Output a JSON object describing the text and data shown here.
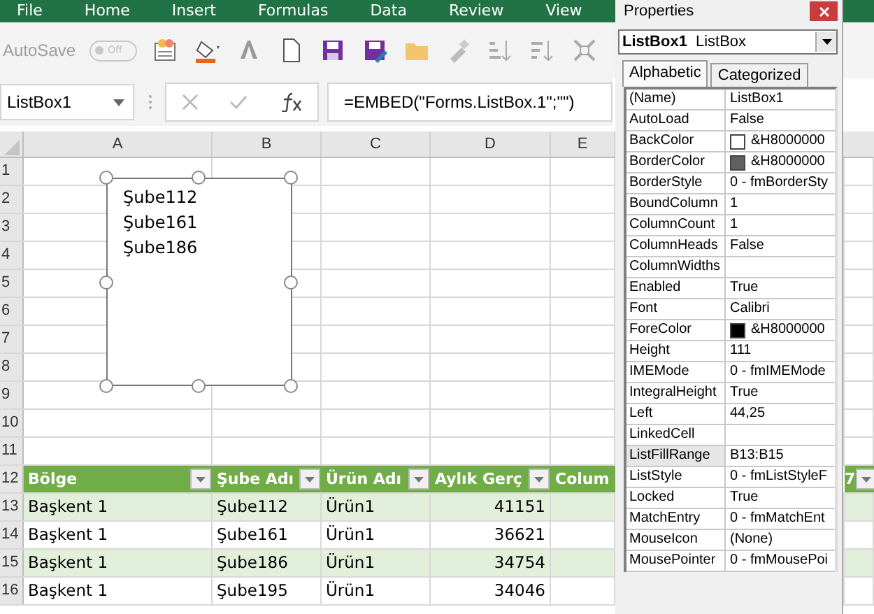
{
  "ribbon_tabs": [
    "File",
    "Home",
    "Insert",
    "Formulas",
    "Data",
    "Review",
    "View"
  ],
  "toolbar": {
    "autosave_label": "AutoSave",
    "autosave_state": "Off",
    "autosave_on": false
  },
  "formula_bar": {
    "name_box": "ListBox1",
    "formula": "=EMBED(\"Forms.ListBox.1\";\"\")"
  },
  "sheet": {
    "columns": [
      "A",
      "B",
      "C",
      "D",
      "E"
    ],
    "row_numbers": [
      "1",
      "2",
      "3",
      "4",
      "5",
      "6",
      "7",
      "8",
      "9",
      "10",
      "11",
      "12",
      "13",
      "14",
      "15",
      "16"
    ],
    "listbox_items": [
      "Şube112",
      "Şube161",
      "Şube186"
    ],
    "table": {
      "columns": [
        "Bölge",
        "Şube Adı",
        "Ürün Adı",
        "Aylık Gerç",
        "Colum",
        "7"
      ],
      "rows": [
        [
          "Başkent 1",
          "Şube112",
          "Ürün1",
          "41151"
        ],
        [
          "Başkent 1",
          "Şube161",
          "Ürün1",
          "36621"
        ],
        [
          "Başkent 1",
          "Şube186",
          "Ürün1",
          "34754"
        ],
        [
          "Başkent 1",
          "Şube195",
          "Ürün1",
          "34046"
        ]
      ]
    }
  },
  "properties": {
    "title": "Properties",
    "object_name": "ListBox1",
    "object_type": "ListBox",
    "tabs": [
      {
        "label": "Alphabetic",
        "selected": true
      },
      {
        "label": "Categorized",
        "selected": false
      }
    ],
    "rows": [
      {
        "name": "(Name)",
        "value": "ListBox1",
        "kind": "text",
        "selected": false
      },
      {
        "name": "AutoLoad",
        "value": "False",
        "kind": "text",
        "selected": false
      },
      {
        "name": "BackColor",
        "value": "&H8000000",
        "kind": "color",
        "color": "#ffffff",
        "selected": false
      },
      {
        "name": "BorderColor",
        "value": "&H8000000",
        "kind": "color",
        "color": "#606060",
        "selected": false
      },
      {
        "name": "BorderStyle",
        "value": "0 - fmBorderSty",
        "kind": "text",
        "selected": false
      },
      {
        "name": "BoundColumn",
        "value": "1",
        "kind": "text",
        "selected": false
      },
      {
        "name": "ColumnCount",
        "value": "1",
        "kind": "text",
        "selected": false
      },
      {
        "name": "ColumnHeads",
        "value": "False",
        "kind": "text",
        "selected": false
      },
      {
        "name": "ColumnWidths",
        "kind": "text",
        "selected": false
      },
      {
        "name": "Enabled",
        "value": "True",
        "kind": "text",
        "selected": false
      },
      {
        "name": "Font",
        "value": "Calibri",
        "kind": "text",
        "selected": false
      },
      {
        "name": "ForeColor",
        "value": "&H8000000",
        "kind": "color",
        "color": "#000000",
        "selected": false
      },
      {
        "name": "Height",
        "value": "111",
        "kind": "text",
        "selected": false
      },
      {
        "name": "IMEMode",
        "value": "0 - fmIMEMode",
        "kind": "text",
        "selected": false
      },
      {
        "name": "IntegralHeight",
        "value": "True",
        "kind": "text",
        "selected": false
      },
      {
        "name": "Left",
        "value": "44,25",
        "kind": "text",
        "selected": false
      },
      {
        "name": "LinkedCell",
        "kind": "text",
        "selected": false
      },
      {
        "name": "ListFillRange",
        "value": "B13:B15",
        "kind": "text",
        "selected": true
      },
      {
        "name": "ListStyle",
        "value": "0 - fmListStyleF",
        "kind": "text",
        "selected": false
      },
      {
        "name": "Locked",
        "value": "True",
        "kind": "text",
        "selected": false
      },
      {
        "name": "MatchEntry",
        "value": "0 - fmMatchEnt",
        "kind": "text",
        "selected": false
      },
      {
        "name": "MouseIcon",
        "value": "(None)",
        "kind": "text",
        "selected": false
      },
      {
        "name": "MousePointer",
        "value": "0 - fmMousePoi",
        "kind": "text",
        "selected": false
      }
    ]
  }
}
